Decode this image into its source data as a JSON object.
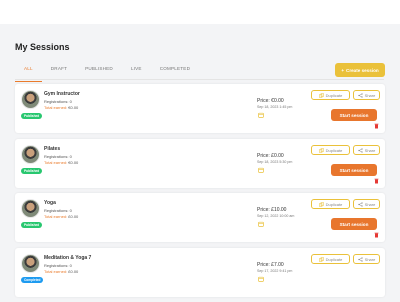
{
  "page": {
    "title": "My Sessions"
  },
  "tabs": [
    "ALL",
    "DRAFT",
    "PUBLISHED",
    "LIVE",
    "COMPLETED"
  ],
  "create_button": {
    "label": "Create session"
  },
  "labels": {
    "registrations": "Registrations:",
    "total_earned": "Total earned:",
    "duplicate": "Duplicate",
    "share": "Share",
    "start": "Start session"
  },
  "colors": {
    "accent": "#ea7b2c",
    "yellow": "#eac13a",
    "published": "#28c76f",
    "completed": "#1e9bf0"
  },
  "sessions": [
    {
      "title": "Gym Instructor",
      "registrations": "0",
      "earned": "€0.00",
      "status": "Published",
      "price": "Price: €0.00",
      "datetime": "Sep 18, 2023 1:45 pm"
    },
    {
      "title": "Pilates",
      "registrations": "0",
      "earned": "€0.00",
      "status": "Published",
      "price": "Price: £0.00",
      "datetime": "Sep 18, 2023 5:30 pm"
    },
    {
      "title": "Yoga",
      "registrations": "0",
      "earned": "£0.00",
      "status": "Published",
      "price": "Price: £10.00",
      "datetime": "Sep 12, 2022 10:00 am"
    },
    {
      "title": "Meditation & Yoga 7",
      "registrations": "0",
      "earned": "£0.00",
      "status": "Completed",
      "price": "Price: £7.00",
      "datetime": "Sep 17, 2022 9:41 pm"
    }
  ]
}
